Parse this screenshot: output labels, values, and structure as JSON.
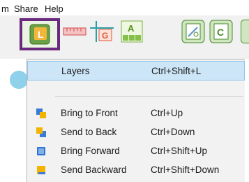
{
  "menubar": {
    "items": [
      "m",
      "Share",
      "Help"
    ]
  },
  "toolbar": {
    "buttons": [
      "layers-icon",
      "ruler-icon",
      "grid-icon",
      "align-icon",
      "edit-image-icon",
      "crop-icon"
    ],
    "accent": "#6a2a7e"
  },
  "menu": {
    "items": [
      {
        "label": "Layers",
        "shortcut": "Ctrl+Shift+L",
        "icon": "",
        "selected": true
      },
      {
        "label": "Bring to Front",
        "shortcut": "Ctrl+Up",
        "icon": "bring-to-front-icon"
      },
      {
        "label": "Send to Back",
        "shortcut": "Ctrl+Down",
        "icon": "send-to-back-icon"
      },
      {
        "label": "Bring Forward",
        "shortcut": "Ctrl+Shift+Up",
        "icon": "bring-forward-icon"
      },
      {
        "label": "Send Backward",
        "shortcut": "Ctrl+Shift+Down",
        "icon": "send-backward-icon"
      }
    ]
  },
  "colors": {
    "menu_bg": "#f2f2f2",
    "selection_bg": "#cde6f7",
    "selection_border": "#8fc4ea"
  }
}
